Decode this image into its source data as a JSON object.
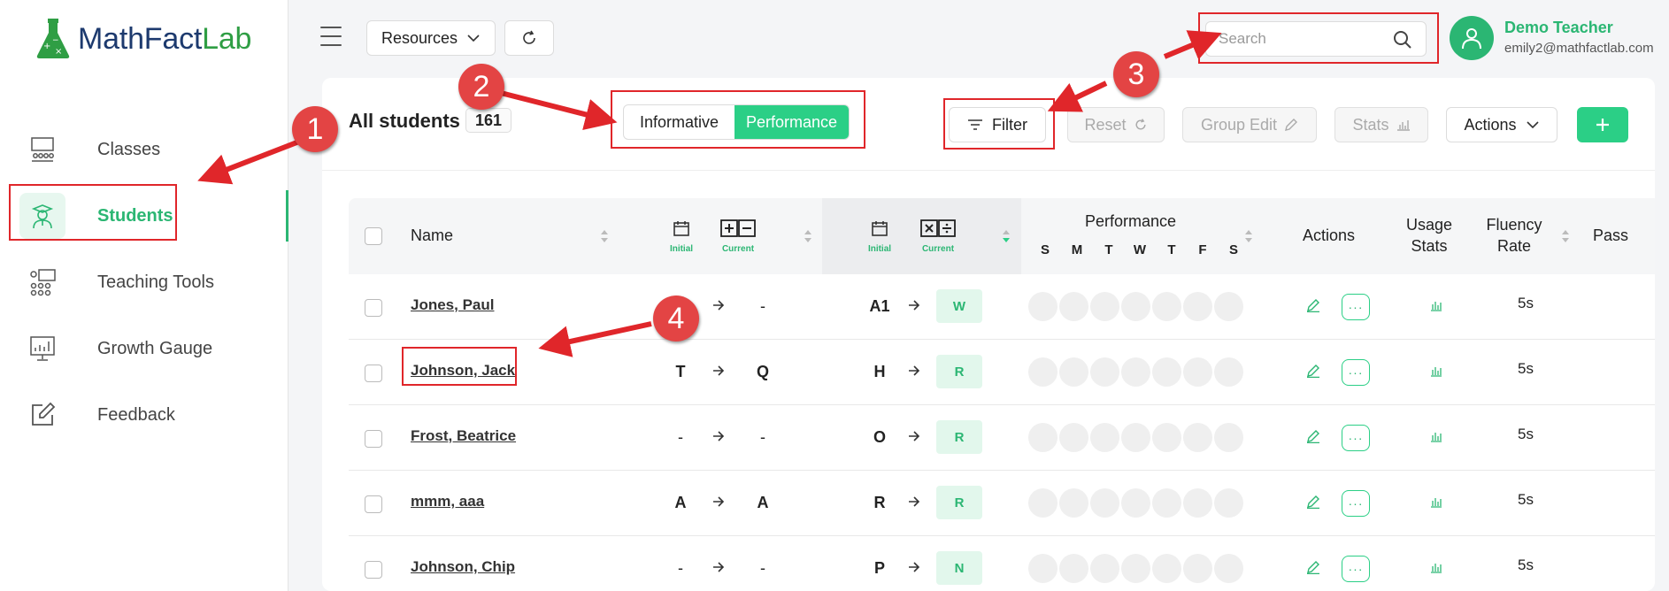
{
  "app": {
    "logo_text_1": "MathFact",
    "logo_text_2": "Lab"
  },
  "sidebar": {
    "items": [
      {
        "label": "Classes",
        "icon": "classroom-icon"
      },
      {
        "label": "Students",
        "icon": "student-icon",
        "active": true
      },
      {
        "label": "Teaching Tools",
        "icon": "teaching-tools-icon"
      },
      {
        "label": "Growth Gauge",
        "icon": "growth-chart-icon"
      },
      {
        "label": "Feedback",
        "icon": "feedback-edit-icon"
      }
    ]
  },
  "topbar": {
    "resources_label": "Resources",
    "search_placeholder": "Search",
    "user_name": "Demo Teacher",
    "user_email": "emily2@mathfactlab.com"
  },
  "toolbar": {
    "title": "All students",
    "count": "161",
    "view_options": [
      "Informative",
      "Performance"
    ],
    "selected_view": "Performance",
    "filter_label": "Filter",
    "reset_label": "Reset",
    "group_edit_label": "Group Edit",
    "stats_label": "Stats",
    "actions_label": "Actions"
  },
  "table": {
    "headers": {
      "name": "Name",
      "initial": "Initial",
      "current": "Current",
      "performance": "Performance",
      "days": [
        "S",
        "M",
        "T",
        "W",
        "T",
        "F",
        "S"
      ],
      "actions": "Actions",
      "usage_stats": "Usage Stats",
      "fluency_rate": "Fluency Rate",
      "pass": "Pass"
    },
    "rows": [
      {
        "name": "Jones, Paul",
        "add_initial": "",
        "add_current": "-",
        "mul_initial": "A1",
        "mul_current": "W",
        "fluency_rate": "5s"
      },
      {
        "name": "Johnson, Jack",
        "add_initial": "T",
        "add_current": "Q",
        "mul_initial": "H",
        "mul_current": "R",
        "fluency_rate": "5s"
      },
      {
        "name": "Frost, Beatrice",
        "add_initial": "-",
        "add_current": "-",
        "mul_initial": "O",
        "mul_current": "R",
        "fluency_rate": "5s"
      },
      {
        "name": "mmm, aaa",
        "add_initial": "A",
        "add_current": "A",
        "mul_initial": "R",
        "mul_current": "R",
        "fluency_rate": "5s"
      },
      {
        "name": "Johnson, Chip",
        "add_initial": "-",
        "add_current": "-",
        "mul_initial": "P",
        "mul_current": "N",
        "fluency_rate": "5s"
      }
    ]
  },
  "annotations": [
    "1",
    "2",
    "3",
    "4"
  ],
  "colors": {
    "accent": "#2bcf86",
    "accent_text": "#2bb673",
    "annotation_red": "#e0262a",
    "brand_blue": "#1d3a6e"
  }
}
